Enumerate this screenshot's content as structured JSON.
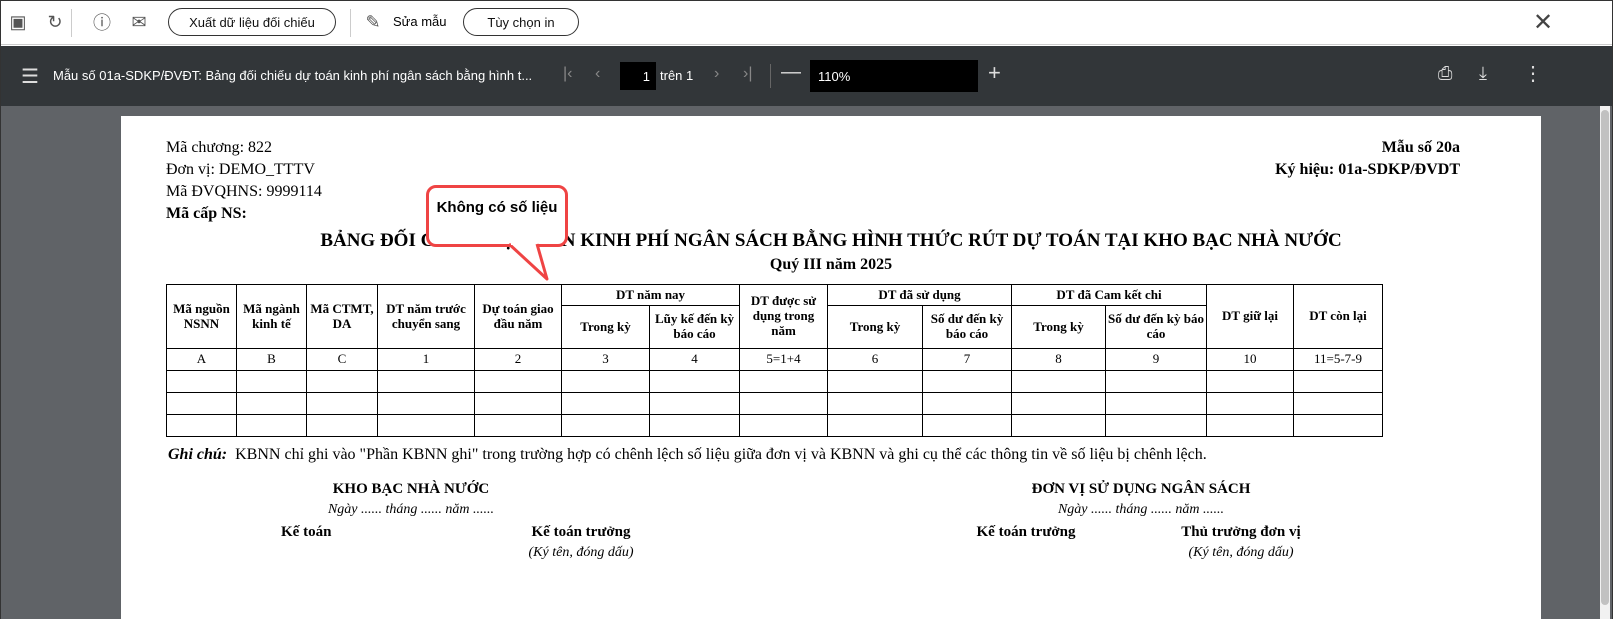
{
  "toolbar": {
    "export_label": "Xuất dữ liệu đối chiếu",
    "edit_label": "Sửa mẫu",
    "print_options_label": "Tùy chọn in"
  },
  "viewer": {
    "title": "Mẫu số 01a-SDKP/ĐVĐT: Bảng đối chiếu dự toán kinh phí ngân sách bằng hình t...",
    "page": "1",
    "page_of": "trên 1",
    "zoom": "110%"
  },
  "doc": {
    "chapter": "Mã chương: 822",
    "unit": "Đơn vị: DEMO_TTTV",
    "qhns": "Mã ĐVQHNS: 9999114",
    "level": "Mã cấp NS:",
    "form_no": "Mẫu số 20a",
    "symbol": "Ký hiệu: 01a-SDKP/ĐVDT",
    "title": "BẢNG ĐỐI CHIẾU DỰ TOÁN KINH PHÍ NGÂN SÁCH BẰNG HÌNH THỨC RÚT DỰ TOÁN TẠI KHO BẠC NHÀ NƯỚC",
    "period": "Quý III năm 2025",
    "headers": [
      "Mã nguồn NSNN",
      "Mã ngành kinh tế",
      "Mã CTMT, DA",
      "DT năm trước chuyển sang",
      "Dự toán giao đầu năm",
      "DT năm nay",
      "DT được sử dụng trong năm",
      "DT đã sử dụng",
      "DT đã Cam kết chi",
      "DT giữ lại",
      "DT còn lại"
    ],
    "sub_headers": [
      "Trong kỳ",
      "Lũy kế đến kỳ báo cáo",
      "Trong kỳ",
      "Số dư đến kỳ báo cáo",
      "Trong kỳ",
      "Số dư đến kỳ báo cáo"
    ],
    "codes": [
      "A",
      "B",
      "C",
      "1",
      "2",
      "3",
      "4",
      "5=1+4",
      "6",
      "7",
      "8",
      "9",
      "10",
      "11=5-7-9"
    ],
    "note_label": "Ghi chú:",
    "note": "KBNN chỉ ghi vào \"Phần KBNN ghi\" trong trường hợp có chênh lệch số liệu giữa đơn vị và KBNN và ghi cụ thể các thông tin về số liệu bị chênh lệch.",
    "left_org": "KHO BẠC NHÀ NƯỚC",
    "right_org": "ĐƠN VỊ SỬ DỤNG NGÂN SÁCH",
    "date_line": "Ngày ...... tháng ...... năm ......",
    "accountant": "Kế toán",
    "chief_accountant": "Kế toán trưởng",
    "head": "Thủ trưởng đơn vị",
    "sign": "(Ký tên, đóng dấu)"
  },
  "callout": "Không có số liệu"
}
